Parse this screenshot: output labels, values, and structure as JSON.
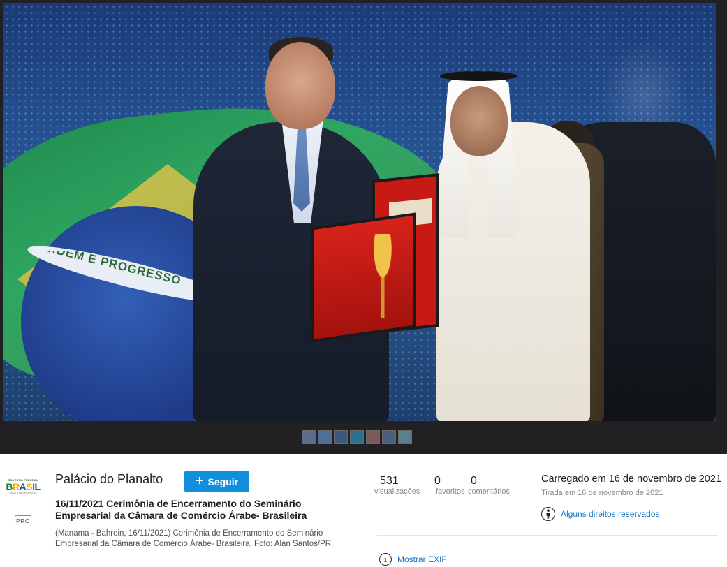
{
  "owner": {
    "name": "Palácio do Planalto",
    "follow_label": "Seguir",
    "badge": "PRO",
    "avatar": {
      "line1": "GOVERNO FEDERAL",
      "brand": "BRASIL",
      "line3": "UNIÃO E RECONSTRUÇÃO"
    }
  },
  "photo": {
    "title": "16/11/2021 Cerimônia de Encerramento do Seminário Empresarial da Câmara de Comércio Árabe- Brasileira",
    "description": "(Manama - Bahrein, 16/11/2021) Cerimônia de Encerramento do Seminário Empresarial da Câmara de Comércio Árabe- Brasileira. Foto: Alan Santos/PR",
    "flag_text": "ORDEM E PROGRESSO",
    "thumbnails": [
      {
        "color": "#5a6e8a"
      },
      {
        "color": "#4f6f95"
      },
      {
        "color": "#3e5878"
      },
      {
        "color": "#2f6f8f"
      },
      {
        "color": "#7a5a5a"
      },
      {
        "color": "#4a5f7a"
      },
      {
        "color": "#5b7f8f"
      }
    ]
  },
  "stats": {
    "views": {
      "value": "531",
      "label": "visualizações"
    },
    "faves": {
      "value": "0",
      "label": "favoritos"
    },
    "comments": {
      "value": "0",
      "label": "comentários"
    }
  },
  "meta": {
    "uploaded": "Carregado em 16 de novembro de 2021",
    "taken": "Tirada em 16 de novembro de 2021",
    "license": "Alguns direitos reservados",
    "exif": "Mostrar EXIF"
  }
}
